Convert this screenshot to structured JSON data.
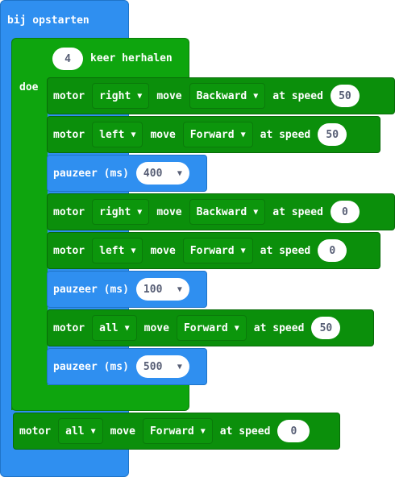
{
  "hat": {
    "label": "bij opstarten"
  },
  "loop": {
    "count": "4",
    "label": "keer herhalen",
    "doe": "doe"
  },
  "labels": {
    "motor": "motor",
    "move": "move",
    "at_speed": "at speed",
    "pauzeer": "pauzeer (ms)"
  },
  "blocks": [
    {
      "motor": "right",
      "direction": "Backward",
      "speed": "50"
    },
    {
      "motor": "left",
      "direction": "Forward",
      "speed": "50"
    },
    {
      "pause": "400"
    },
    {
      "motor": "right",
      "direction": "Backward",
      "speed": "0"
    },
    {
      "motor": "left",
      "direction": "Forward",
      "speed": "0"
    },
    {
      "pause": "100"
    },
    {
      "motor": "all",
      "direction": "Forward",
      "speed": "50"
    },
    {
      "pause": "500"
    }
  ],
  "final": {
    "motor": "all",
    "direction": "Forward",
    "speed": "0"
  },
  "icons": {
    "dropdown": "caret-down-icon"
  },
  "colors": {
    "event": "#2f8ff0",
    "loop": "#0ea50e",
    "motor": "#0b8f0b",
    "pause": "#2f8ff0"
  }
}
